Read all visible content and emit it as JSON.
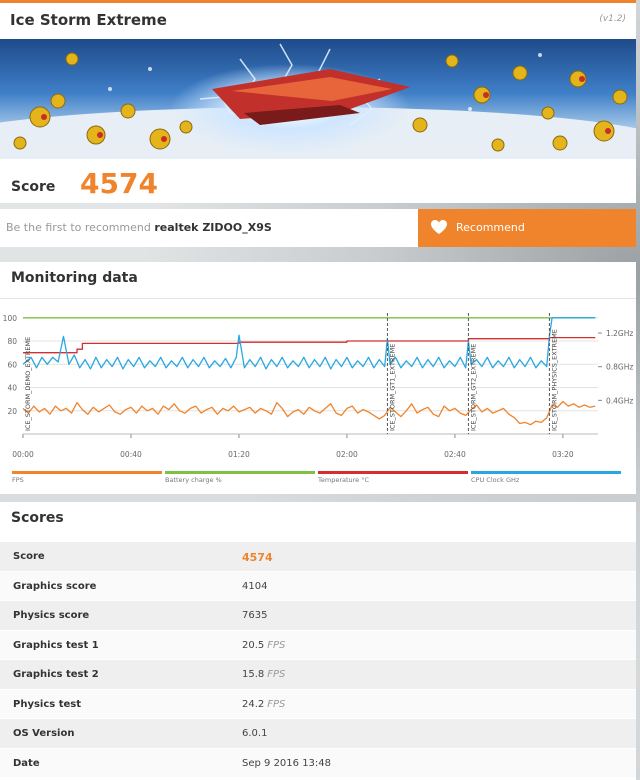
{
  "header": {
    "title": "Ice Storm Extreme",
    "version": "(v1.2)",
    "score_label": "Score",
    "score_value": "4574"
  },
  "recommend": {
    "prompt": "Be the first to recommend",
    "device": "realtek ZIDOO_X9S",
    "button_label": "Recommend"
  },
  "monitoring": {
    "title": "Monitoring data",
    "chart_data": {
      "type": "line",
      "x_ticks": [
        "00:00",
        "00:40",
        "01:20",
        "02:00",
        "02:40",
        "03:20"
      ],
      "x_tick_seconds": [
        0,
        40,
        80,
        120,
        160,
        200
      ],
      "x_range_seconds": [
        0,
        213
      ],
      "y_left_ticks": [
        20,
        40,
        60,
        80,
        100
      ],
      "y_left_range": [
        0,
        105
      ],
      "y_right_ticks": [
        "1.2GHz",
        "0.8GHz",
        "0.4GHz"
      ],
      "y_right_tick_values": [
        1.2,
        0.8,
        0.4
      ],
      "y_right_range": [
        0,
        1.45
      ],
      "markers": [
        {
          "label": "ICE_STORM_DEMO_EXTREME",
          "t": 0
        },
        {
          "label": "ICE_STORM_GT1_EXTREME",
          "t": 135
        },
        {
          "label": "ICE_STORM_GT2_EXTREME",
          "t": 165
        },
        {
          "label": "ICE_STORM_PHYSICS_EXTREME",
          "t": 195
        }
      ],
      "series": [
        {
          "name": "FPS",
          "color": "#f0842c",
          "points": [
            [
              0,
              22
            ],
            [
              2,
              18
            ],
            [
              4,
              24
            ],
            [
              6,
              19
            ],
            [
              8,
              22
            ],
            [
              10,
              17
            ],
            [
              12,
              24
            ],
            [
              14,
              20
            ],
            [
              16,
              22
            ],
            [
              18,
              18
            ],
            [
              20,
              27
            ],
            [
              22,
              21
            ],
            [
              24,
              17
            ],
            [
              26,
              23
            ],
            [
              28,
              19
            ],
            [
              30,
              22
            ],
            [
              32,
              25
            ],
            [
              34,
              19
            ],
            [
              36,
              17
            ],
            [
              38,
              21
            ],
            [
              40,
              23
            ],
            [
              42,
              18
            ],
            [
              44,
              24
            ],
            [
              46,
              20
            ],
            [
              48,
              22
            ],
            [
              50,
              17
            ],
            [
              52,
              24
            ],
            [
              54,
              21
            ],
            [
              56,
              26
            ],
            [
              58,
              20
            ],
            [
              60,
              18
            ],
            [
              62,
              22
            ],
            [
              64,
              24
            ],
            [
              66,
              18
            ],
            [
              68,
              21
            ],
            [
              70,
              23
            ],
            [
              72,
              17
            ],
            [
              74,
              22
            ],
            [
              76,
              20
            ],
            [
              78,
              24
            ],
            [
              80,
              19
            ],
            [
              82,
              21
            ],
            [
              84,
              23
            ],
            [
              86,
              18
            ],
            [
              88,
              22
            ],
            [
              90,
              20
            ],
            [
              92,
              17
            ],
            [
              94,
              27
            ],
            [
              96,
              22
            ],
            [
              98,
              15
            ],
            [
              100,
              19
            ],
            [
              102,
              21
            ],
            [
              104,
              17
            ],
            [
              106,
              23
            ],
            [
              108,
              20
            ],
            [
              110,
              18
            ],
            [
              112,
              22
            ],
            [
              114,
              26
            ],
            [
              116,
              18
            ],
            [
              118,
              16
            ],
            [
              120,
              22
            ],
            [
              122,
              24
            ],
            [
              124,
              18
            ],
            [
              126,
              21
            ],
            [
              128,
              19
            ],
            [
              130,
              16
            ],
            [
              132,
              13
            ],
            [
              134,
              16
            ],
            [
              136,
              23
            ],
            [
              138,
              19
            ],
            [
              140,
              15
            ],
            [
              142,
              20
            ],
            [
              144,
              26
            ],
            [
              146,
              18
            ],
            [
              148,
              21
            ],
            [
              150,
              23
            ],
            [
              152,
              17
            ],
            [
              154,
              15
            ],
            [
              156,
              24
            ],
            [
              158,
              20
            ],
            [
              160,
              22
            ],
            [
              162,
              18
            ],
            [
              164,
              16
            ],
            [
              166,
              21
            ],
            [
              168,
              25
            ],
            [
              170,
              19
            ],
            [
              172,
              22
            ],
            [
              174,
              18
            ],
            [
              176,
              20
            ],
            [
              178,
              22
            ],
            [
              180,
              17
            ],
            [
              182,
              14
            ],
            [
              184,
              9
            ],
            [
              186,
              10
            ],
            [
              188,
              8
            ],
            [
              190,
              11
            ],
            [
              192,
              10
            ],
            [
              194,
              14
            ],
            [
              196,
              25
            ],
            [
              198,
              23
            ],
            [
              200,
              28
            ],
            [
              202,
              24
            ],
            [
              204,
              26
            ],
            [
              206,
              23
            ],
            [
              208,
              25
            ],
            [
              210,
              23
            ],
            [
              212,
              24
            ]
          ]
        },
        {
          "name": "Battery charge %",
          "color": "#7dc242",
          "points": [
            [
              0,
              100
            ],
            [
              212,
              100
            ]
          ]
        },
        {
          "name": "Temperature °C",
          "color": "#d32f2f",
          "points": [
            [
              0,
              70
            ],
            [
              20,
              70
            ],
            [
              20,
              73
            ],
            [
              22,
              73
            ],
            [
              22,
              78
            ],
            [
              80,
              78
            ],
            [
              80,
              79
            ],
            [
              120,
              79
            ],
            [
              120,
              80
            ],
            [
              165,
              80
            ],
            [
              165,
              82
            ],
            [
              195,
              82
            ],
            [
              195,
              83
            ],
            [
              212,
              83
            ]
          ]
        },
        {
          "name": "CPU Clock GHz",
          "color": "#29a8e0",
          "points": [
            [
              0,
              60
            ],
            [
              3,
              66
            ],
            [
              5,
              57
            ],
            [
              7,
              66
            ],
            [
              9,
              60
            ],
            [
              11,
              66
            ],
            [
              13,
              62
            ],
            [
              15,
              84
            ],
            [
              17,
              60
            ],
            [
              19,
              68
            ],
            [
              21,
              57
            ],
            [
              23,
              64
            ],
            [
              25,
              56
            ],
            [
              27,
              66
            ],
            [
              29,
              57
            ],
            [
              31,
              64
            ],
            [
              33,
              58
            ],
            [
              35,
              66
            ],
            [
              37,
              56
            ],
            [
              39,
              64
            ],
            [
              41,
              58
            ],
            [
              43,
              66
            ],
            [
              45,
              57
            ],
            [
              47,
              63
            ],
            [
              49,
              58
            ],
            [
              51,
              66
            ],
            [
              53,
              57
            ],
            [
              55,
              63
            ],
            [
              57,
              58
            ],
            [
              59,
              66
            ],
            [
              61,
              57
            ],
            [
              63,
              64
            ],
            [
              65,
              58
            ],
            [
              67,
              66
            ],
            [
              69,
              57
            ],
            [
              71,
              63
            ],
            [
              73,
              58
            ],
            [
              75,
              65
            ],
            [
              77,
              57
            ],
            [
              79,
              66
            ],
            [
              80,
              85
            ],
            [
              82,
              57
            ],
            [
              84,
              64
            ],
            [
              86,
              58
            ],
            [
              88,
              66
            ],
            [
              90,
              56
            ],
            [
              92,
              64
            ],
            [
              94,
              58
            ],
            [
              96,
              66
            ],
            [
              98,
              57
            ],
            [
              100,
              63
            ],
            [
              102,
              58
            ],
            [
              104,
              66
            ],
            [
              106,
              57
            ],
            [
              108,
              64
            ],
            [
              110,
              58
            ],
            [
              112,
              66
            ],
            [
              114,
              56
            ],
            [
              116,
              64
            ],
            [
              118,
              58
            ],
            [
              120,
              66
            ],
            [
              122,
              57
            ],
            [
              124,
              63
            ],
            [
              126,
              58
            ],
            [
              128,
              66
            ],
            [
              130,
              57
            ],
            [
              132,
              64
            ],
            [
              134,
              58
            ],
            [
              135,
              82
            ],
            [
              136,
              60
            ],
            [
              138,
              66
            ],
            [
              140,
              57
            ],
            [
              142,
              63
            ],
            [
              144,
              58
            ],
            [
              146,
              66
            ],
            [
              148,
              57
            ],
            [
              150,
              64
            ],
            [
              152,
              58
            ],
            [
              154,
              66
            ],
            [
              156,
              57
            ],
            [
              158,
              63
            ],
            [
              160,
              58
            ],
            [
              162,
              66
            ],
            [
              164,
              57
            ],
            [
              165,
              80
            ],
            [
              166,
              60
            ],
            [
              168,
              64
            ],
            [
              170,
              58
            ],
            [
              172,
              66
            ],
            [
              174,
              57
            ],
            [
              176,
              63
            ],
            [
              178,
              58
            ],
            [
              180,
              66
            ],
            [
              182,
              57
            ],
            [
              184,
              64
            ],
            [
              186,
              58
            ],
            [
              188,
              66
            ],
            [
              190,
              57
            ],
            [
              192,
              63
            ],
            [
              194,
              58
            ],
            [
              195,
              84
            ],
            [
              196,
              100
            ],
            [
              198,
              100
            ],
            [
              212,
              100
            ]
          ]
        }
      ],
      "legend": [
        "FPS",
        "Battery charge %",
        "Temperature °C",
        "CPU Clock GHz"
      ]
    }
  },
  "scores": {
    "title": "Scores",
    "rows": [
      {
        "label": "Score",
        "value": "4574",
        "unit": ""
      },
      {
        "label": "Graphics score",
        "value": "4104",
        "unit": ""
      },
      {
        "label": "Physics score",
        "value": "7635",
        "unit": ""
      },
      {
        "label": "Graphics test 1",
        "value": "20.5",
        "unit": "FPS"
      },
      {
        "label": "Graphics test 2",
        "value": "15.8",
        "unit": "FPS"
      },
      {
        "label": "Physics test",
        "value": "24.2",
        "unit": "FPS"
      },
      {
        "label": "OS Version",
        "value": "6.0.1",
        "unit": ""
      },
      {
        "label": "Date",
        "value": "Sep 9 2016 13:48",
        "unit": ""
      }
    ]
  },
  "colors": {
    "accent": "#f0842c",
    "fps": "#f0842c",
    "battery": "#7dc242",
    "temperature": "#d32f2f",
    "cpu": "#29a8e0"
  },
  "icons": {
    "heart": "heart-icon",
    "banner": "banner-image"
  }
}
